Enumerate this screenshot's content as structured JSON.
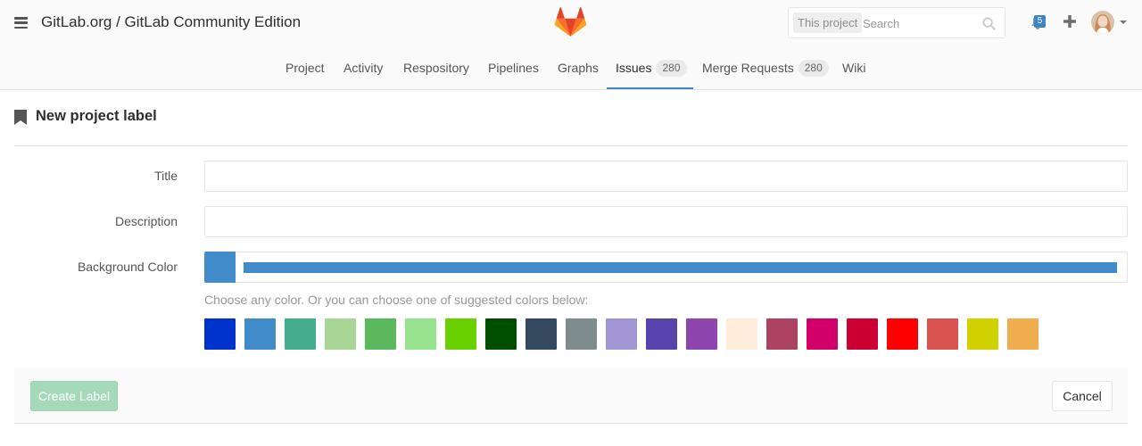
{
  "header": {
    "title": "GitLab.org / GitLab Community Edition",
    "search_scope": "This project",
    "search_placeholder": "Search",
    "todo_count": "5"
  },
  "nav": {
    "tabs": [
      {
        "label": "Project"
      },
      {
        "label": "Activity"
      },
      {
        "label": "Respository"
      },
      {
        "label": "Pipelines"
      },
      {
        "label": "Graphs"
      },
      {
        "label": "Issues",
        "count": "280",
        "active": true
      },
      {
        "label": "Merge Requests",
        "count": "280"
      },
      {
        "label": "Wiki"
      }
    ]
  },
  "page": {
    "title": "New project label"
  },
  "form": {
    "title_label": "Title",
    "title_value": "",
    "description_label": "Description",
    "description_value": "",
    "color_label": "Background Color",
    "color_value": "#428BCA",
    "color_help": "Choose any color. Or you can choose one of suggested colors below:",
    "suggested_colors": [
      "#0033CC",
      "#428BCA",
      "#44AD8E",
      "#A8D695",
      "#5CB85C",
      "#69D100",
      "#004E00",
      "#34495E",
      "#7F8C8D",
      "#A295D6",
      "#5843AD",
      "#8E44AD",
      "#FFECDB",
      "#AD4363",
      "#D10069",
      "#CC0033",
      "#FF0000",
      "#D9534F",
      "#D1D100",
      "#F0AD4E",
      "#AD8D43"
    ],
    "swatches": [
      "#0033CC",
      "#428BCA",
      "#44AD8E",
      "#A8D695",
      "#5CB85C",
      "#96E28F",
      "#69D100",
      "#004E00",
      "#34495E",
      "#7F8C8D",
      "#A295D6",
      "#5843AD",
      "#8E44AD",
      "#FFECDB",
      "#AD4363",
      "#D10069",
      "#CC0033",
      "#FF0000",
      "#D9534F",
      "#D1D100",
      "#F0AD4E"
    ]
  },
  "actions": {
    "create_label": "Create Label",
    "cancel_label": "Cancel"
  }
}
